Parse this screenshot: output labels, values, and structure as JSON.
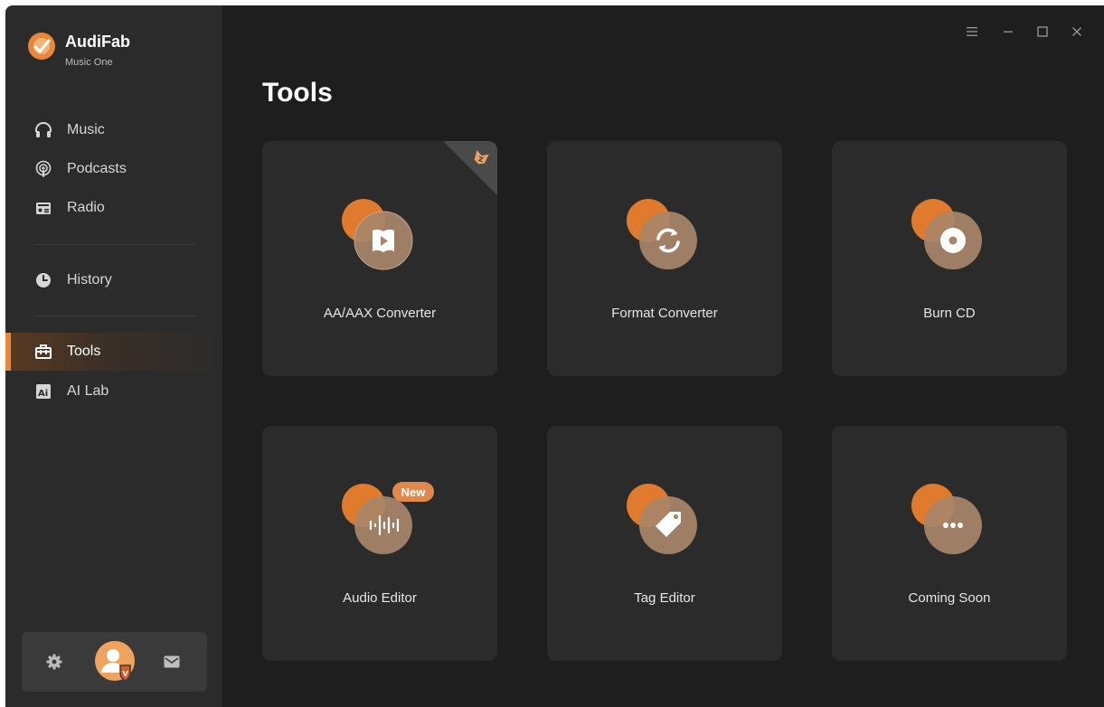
{
  "app": {
    "name": "AudiFab",
    "subtitle": "Music One"
  },
  "sidebar": {
    "items": [
      {
        "label": "Music",
        "icon": "headphones-icon"
      },
      {
        "label": "Podcasts",
        "icon": "podcast-icon"
      },
      {
        "label": "Radio",
        "icon": "radio-icon"
      },
      {
        "label": "History",
        "icon": "clock-icon"
      },
      {
        "label": "Tools",
        "icon": "toolbox-icon",
        "active": true
      },
      {
        "label": "AI Lab",
        "icon": "ai-icon"
      }
    ]
  },
  "page": {
    "title": "Tools"
  },
  "tools": [
    {
      "label": "AA/AAX Converter",
      "icon": "book-play-icon"
    },
    {
      "label": "Format Converter",
      "icon": "convert-icon"
    },
    {
      "label": "Burn CD",
      "icon": "disc-icon"
    },
    {
      "label": "Audio Editor",
      "icon": "waveform-icon",
      "badge": "New"
    },
    {
      "label": "Tag Editor",
      "icon": "tag-icon"
    },
    {
      "label": "Coming Soon",
      "icon": "more-icon"
    }
  ],
  "colors": {
    "accent": "#e8863a",
    "background": "#1e1e1e",
    "sidebar": "#2b2b2b",
    "card": "#2b2b2b"
  }
}
